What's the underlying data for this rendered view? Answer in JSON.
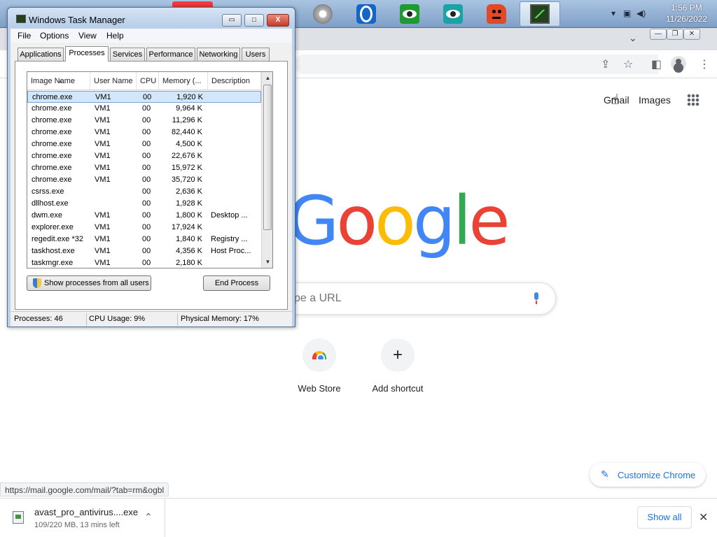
{
  "taskbar": {
    "clock_time": "1:56 PM",
    "clock_date": "11/26/2022",
    "tray_icons": [
      "show-hidden-icon",
      "network-icon",
      "volume-icon"
    ],
    "apps": [
      "opera-gx-icon",
      "opera-icon",
      "eye-app-icon",
      "eye-app-icon",
      "red-face-icon",
      "task-manager-icon"
    ]
  },
  "task_manager": {
    "title": "Windows Task Manager",
    "controls": {
      "minimize": "▭",
      "maximize": "□",
      "close": "X"
    },
    "menu": [
      "File",
      "Options",
      "View",
      "Help"
    ],
    "tabs": [
      "Applications",
      "Processes",
      "Services",
      "Performance",
      "Networking",
      "Users"
    ],
    "active_tab": "Processes",
    "columns": [
      "Image Name",
      "User Name",
      "CPU",
      "Memory (...",
      "Description"
    ],
    "rows": [
      {
        "name": "chrome.exe",
        "user": "VM1",
        "cpu": "00",
        "mem": "1,920 K",
        "desc": ""
      },
      {
        "name": "chrome.exe",
        "user": "VM1",
        "cpu": "00",
        "mem": "9,964 K",
        "desc": ""
      },
      {
        "name": "chrome.exe",
        "user": "VM1",
        "cpu": "00",
        "mem": "11,296 K",
        "desc": ""
      },
      {
        "name": "chrome.exe",
        "user": "VM1",
        "cpu": "00",
        "mem": "82,440 K",
        "desc": ""
      },
      {
        "name": "chrome.exe",
        "user": "VM1",
        "cpu": "00",
        "mem": "4,500 K",
        "desc": ""
      },
      {
        "name": "chrome.exe",
        "user": "VM1",
        "cpu": "00",
        "mem": "22,676 K",
        "desc": ""
      },
      {
        "name": "chrome.exe",
        "user": "VM1",
        "cpu": "00",
        "mem": "15,972 K",
        "desc": ""
      },
      {
        "name": "chrome.exe",
        "user": "VM1",
        "cpu": "00",
        "mem": "35,720 K",
        "desc": ""
      },
      {
        "name": "csrss.exe",
        "user": "",
        "cpu": "00",
        "mem": "2,636 K",
        "desc": ""
      },
      {
        "name": "dllhost.exe",
        "user": "",
        "cpu": "00",
        "mem": "1,928 K",
        "desc": ""
      },
      {
        "name": "dwm.exe",
        "user": "VM1",
        "cpu": "00",
        "mem": "1,800 K",
        "desc": "Desktop ..."
      },
      {
        "name": "explorer.exe",
        "user": "VM1",
        "cpu": "00",
        "mem": "17,924 K",
        "desc": ""
      },
      {
        "name": "regedit.exe *32",
        "user": "VM1",
        "cpu": "00",
        "mem": "1,840 K",
        "desc": "Registry ..."
      },
      {
        "name": "taskhost.exe",
        "user": "VM1",
        "cpu": "00",
        "mem": "4,356 K",
        "desc": "Host Proc..."
      },
      {
        "name": "taskmgr.exe",
        "user": "VM1",
        "cpu": "00",
        "mem": "2,180 K",
        "desc": ""
      }
    ],
    "show_all_label": "Show processes from all users",
    "end_process_label": "End Process",
    "status": {
      "processes": "Processes: 46",
      "cpu": "CPU Usage: 9%",
      "memory": "Physical Memory: 17%"
    }
  },
  "chrome": {
    "window_controls": {
      "minimize": "—",
      "restore": "❐",
      "close": "✕"
    },
    "toolbar_icons": [
      "share-icon",
      "bookmark-star-icon",
      "side-panel-icon",
      "profile-icon",
      "menu-icon"
    ],
    "gmail": "Gmail",
    "images": "Images",
    "logo_letters": [
      "G",
      "o",
      "o",
      "g",
      "l",
      "e"
    ],
    "logo_colors": [
      "#4285f4",
      "#ea4335",
      "#fbbc05",
      "#4285f4",
      "#34a853",
      "#ea4335"
    ],
    "search_placeholder": "pe a URL",
    "shortcuts": [
      {
        "label": "Web Store"
      },
      {
        "label": "Add shortcut"
      }
    ],
    "plus": "+",
    "customize_label": "Customize Chrome",
    "status_url": "https://mail.google.com/mail/?tab=rm&ogbl",
    "download": {
      "filename": "avast_pro_antivirus....exe",
      "status": "109/220 MB, 13 mins left"
    },
    "show_all": "Show all"
  }
}
